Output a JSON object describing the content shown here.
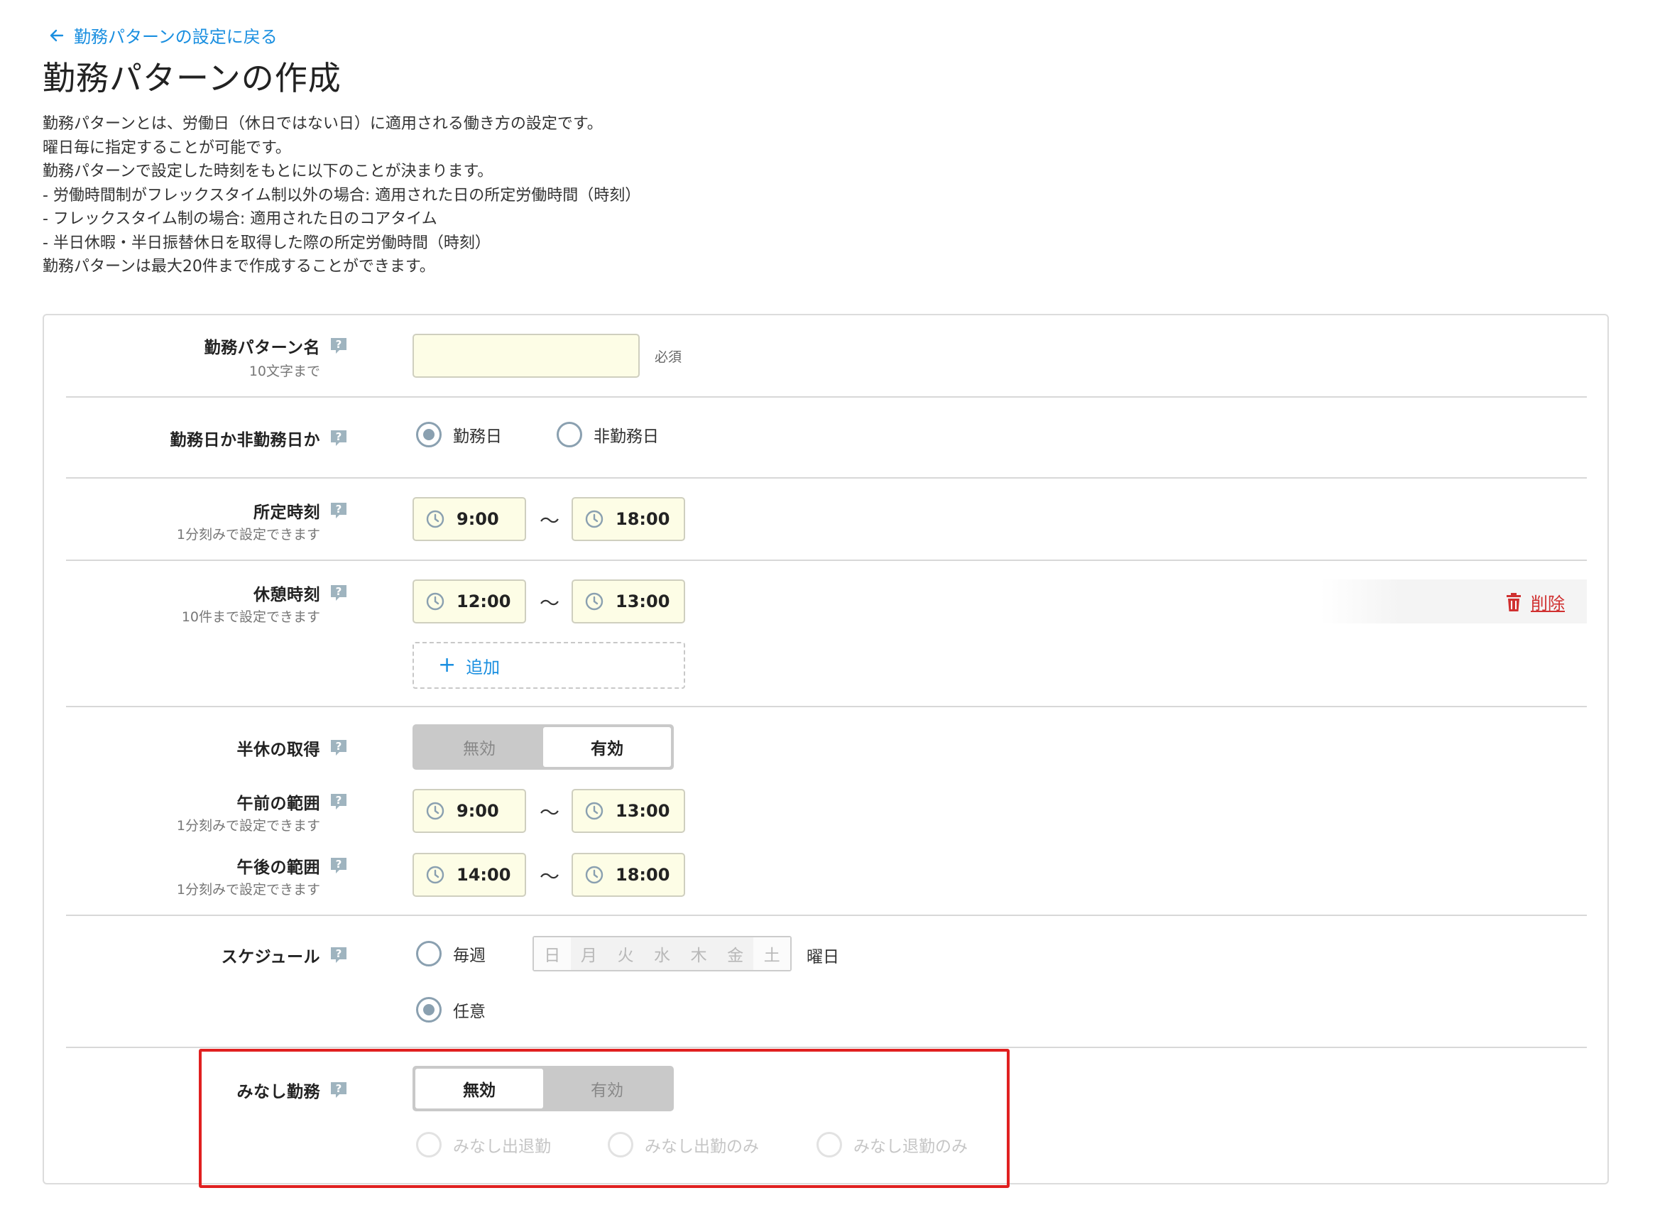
{
  "nav": {
    "back_label": "勤務パターンの設定に戻る"
  },
  "page": {
    "title": "勤務パターンの作成",
    "description": [
      "勤務パターンとは、労働日（休日ではない日）に適用される働き方の設定です。",
      "曜日毎に指定することが可能です。",
      "勤務パターンで設定した時刻をもとに以下のことが決まります。",
      "- 労働時間制がフレックスタイム制以外の場合: 適用された日の所定労働時間（時刻）",
      "- フレックスタイム制の場合: 適用された日のコアタイム",
      "- 半日休暇・半日振替休日を取得した際の所定労働時間（時刻）",
      "勤務パターンは最大20件まで作成することができます。"
    ]
  },
  "form": {
    "name": {
      "label": "勤務パターン名",
      "sublabel": "10文字まで",
      "value": "",
      "required": "必須"
    },
    "day_type": {
      "label": "勤務日か非勤務日か",
      "options": [
        "勤務日",
        "非勤務日"
      ],
      "selected": "勤務日"
    },
    "scheduled_time": {
      "label": "所定時刻",
      "sublabel": "1分刻みで設定できます",
      "start": "9:00",
      "end": "18:00",
      "separator": "〜"
    },
    "break_time": {
      "label": "休憩時刻",
      "sublabel": "10件まで設定できます",
      "start": "12:00",
      "end": "13:00",
      "separator": "〜",
      "delete_label": "削除",
      "add_label": "追加"
    },
    "half_day": {
      "label": "半休の取得",
      "options": [
        "無効",
        "有効"
      ],
      "selected": "有効"
    },
    "morning_range": {
      "label": "午前の範囲",
      "sublabel": "1分刻みで設定できます",
      "start": "9:00",
      "end": "13:00",
      "separator": "〜"
    },
    "afternoon_range": {
      "label": "午後の範囲",
      "sublabel": "1分刻みで設定できます",
      "start": "14:00",
      "end": "18:00",
      "separator": "〜"
    },
    "schedule": {
      "label": "スケジュール",
      "weekly_label": "毎週",
      "weekdays": [
        "日",
        "月",
        "火",
        "水",
        "木",
        "金",
        "土"
      ],
      "weekday_suffix": "曜日",
      "arbitrary_label": "任意",
      "selected": "任意"
    },
    "deemed_work": {
      "label": "みなし勤務",
      "options": [
        "無効",
        "有効"
      ],
      "selected": "無効",
      "sub_options": [
        "みなし出退勤",
        "みなし出勤のみ",
        "みなし退勤のみ"
      ]
    }
  },
  "colors": {
    "link": "#1a8fe0",
    "delete": "#d03030",
    "input_bg": "#fdfde6",
    "highlight": "#e02020",
    "radio": "#8aa0b0"
  }
}
